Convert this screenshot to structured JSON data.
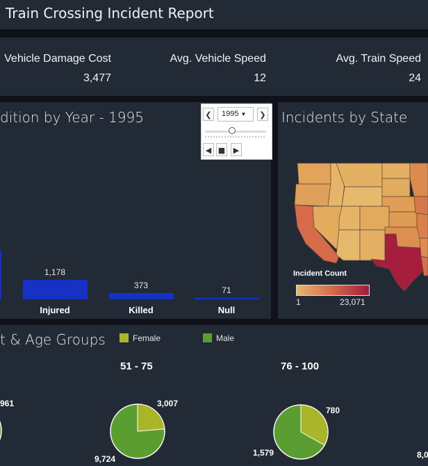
{
  "header": {
    "title": "Train Crossing Incident Report"
  },
  "kpis": [
    {
      "label": "Vehicle Damage Cost",
      "value": "3,477"
    },
    {
      "label": "Avg. Vehicle Speed",
      "value": "12"
    },
    {
      "label": "Avg. Train Speed",
      "value": "24"
    }
  ],
  "condition_panel": {
    "title": "dition by Year - 1995",
    "player": {
      "selected_year": "1995",
      "prev_icon": "chevron-left-icon",
      "next_icon": "chevron-right-icon",
      "play_back_icon": "play-back-icon",
      "stop_icon": "stop-icon",
      "play_forward_icon": "play-forward-icon"
    }
  },
  "map_panel": {
    "title": "Incidents by State",
    "legend_title": "Incident Count",
    "legend_min": "1",
    "legend_max": "23,071",
    "color_low": "#e8b66a",
    "color_high": "#a31a3c"
  },
  "demographics_panel": {
    "title": "t & Age Groups",
    "legend": [
      {
        "label": "Female",
        "color": "#a8b628"
      },
      {
        "label": "Male",
        "color": "#5a9e31"
      }
    ],
    "groups": [
      {
        "label": "",
        "female_label": "",
        "male_label": "961"
      },
      {
        "label": "51 - 75",
        "female_label": "3,007",
        "male_label": "9,724"
      },
      {
        "label": "76 - 100",
        "female_label": "780",
        "male_label": "1,579"
      },
      {
        "label": "",
        "female_label": "",
        "male_label": "8,0"
      }
    ]
  },
  "chart_data": [
    {
      "type": "bar",
      "title": "dition by Year - 1995",
      "categories": [
        "Injured",
        "Killed",
        "Null"
      ],
      "values": [
        1178,
        373,
        71
      ],
      "value_labels": [
        "1,178",
        "373",
        "71"
      ],
      "color": "#1632c6"
    },
    {
      "type": "pie",
      "title": "51 - 75",
      "series": [
        {
          "name": "Female",
          "values": [
            3007
          ]
        },
        {
          "name": "Male",
          "values": [
            9724
          ]
        }
      ]
    },
    {
      "type": "pie",
      "title": "76 - 100",
      "series": [
        {
          "name": "Female",
          "values": [
            780
          ]
        },
        {
          "name": "Male",
          "values": [
            1579
          ]
        }
      ]
    }
  ]
}
